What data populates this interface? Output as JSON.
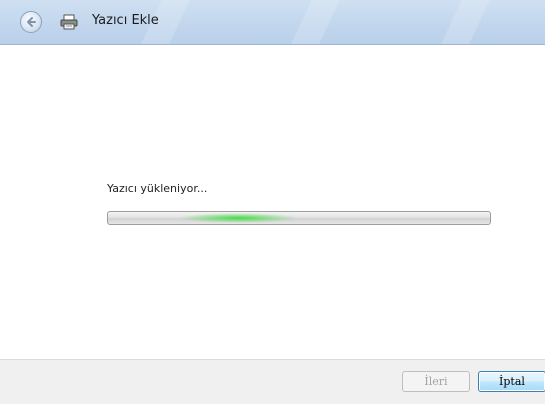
{
  "window": {
    "title": "Yazıcı Ekle"
  },
  "status": {
    "message": "Yazıcı yükleniyor..."
  },
  "progress": {
    "mode": "indeterminate",
    "accent_color": "#3cd23c"
  },
  "buttons": {
    "next_label": "İleri",
    "next_enabled": false,
    "cancel_label": "İptal"
  },
  "icons": {
    "back": "back-arrow-icon",
    "app": "printer-icon"
  }
}
